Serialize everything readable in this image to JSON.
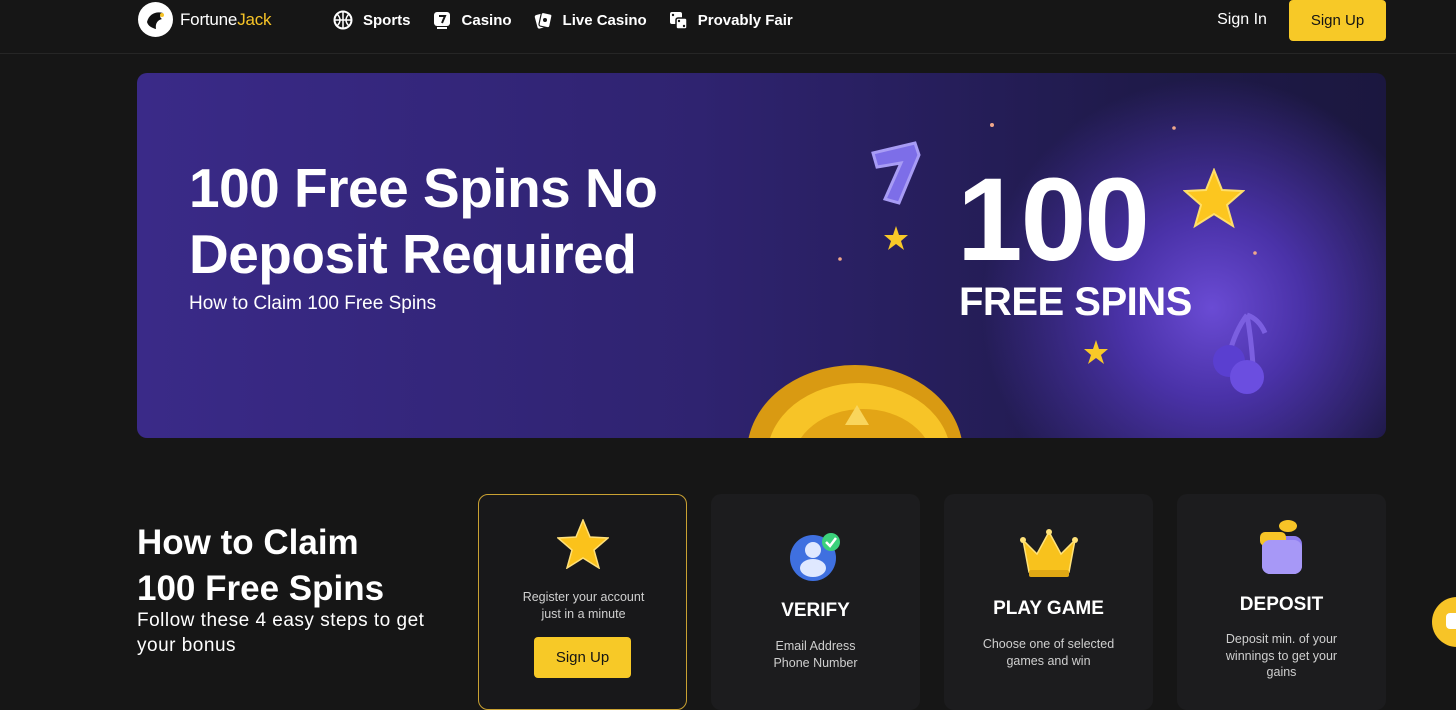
{
  "header": {
    "brand_a": "Fortune",
    "brand_b": "Jack",
    "nav": [
      {
        "label": "Sports",
        "icon": "basketball-icon"
      },
      {
        "label": "Casino",
        "icon": "slot-seven-icon"
      },
      {
        "label": "Live Casino",
        "icon": "playing-cards-icon"
      },
      {
        "label": "Provably Fair",
        "icon": "dice-icon"
      }
    ],
    "signin_label": "Sign In",
    "signup_label": "Sign Up"
  },
  "hero": {
    "title": "100 Free Spins No Deposit Required",
    "subtitle": "How to Claim 100 Free Spins",
    "graphic_number": "100",
    "graphic_caption": "FREE SPINS"
  },
  "claim": {
    "title_line1": "How to Claim",
    "title_line2": "100 Free Spins",
    "subtitle": "Follow these 4 easy steps to get your bonus",
    "steps": [
      {
        "icon": "star-icon",
        "title": "",
        "desc_line1": "Register your account",
        "desc_line2": "just in a minute",
        "button": "Sign Up"
      },
      {
        "icon": "verified-user-icon",
        "title": "VERIFY",
        "desc_line1": "Email Address",
        "desc_line2": "Phone Number"
      },
      {
        "icon": "crown-icon",
        "title": "PLAY GAME",
        "desc_line1": "Choose one of selected",
        "desc_line2": "games and win"
      },
      {
        "icon": "wallet-coin-icon",
        "title": "DEPOSIT",
        "desc_line1": "Deposit min. of your",
        "desc_line2": "winnings to get your",
        "desc_line3": "gains"
      }
    ]
  },
  "colors": {
    "accent": "#f7c927",
    "background": "#161616",
    "hero_purple": "#3a2a88"
  }
}
